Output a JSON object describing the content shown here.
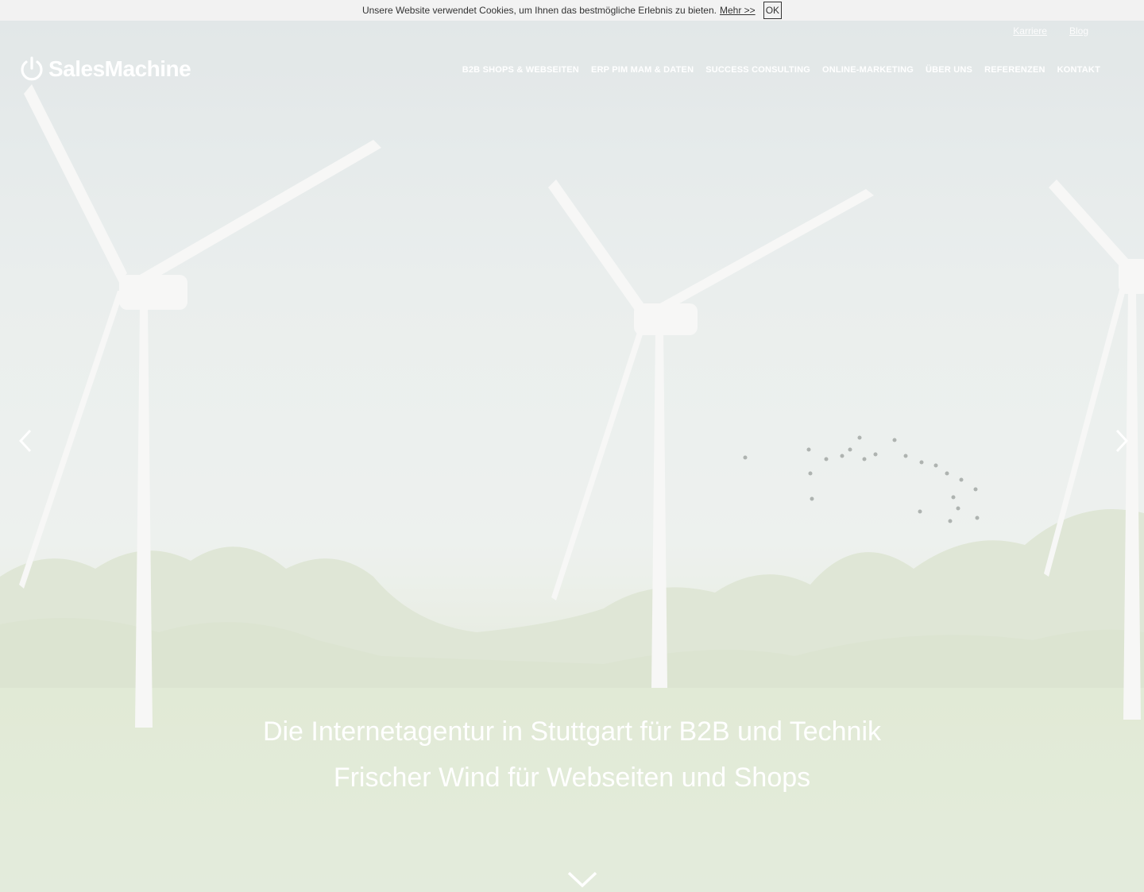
{
  "cookie": {
    "text": "Unsere Website verwendet Cookies, um Ihnen das bestmögliche Erlebnis zu bieten.",
    "more_label": "Mehr >>",
    "ok_label": "OK"
  },
  "top_links": [
    "Karriere",
    "Blog"
  ],
  "logo": {
    "text": "SalesMachine"
  },
  "nav": [
    "B2B SHOPS & WEBSEITEN",
    "ERP PIM MAM & DATEN",
    "SUCCESS CONSULTING",
    "ONLINE-MARKETING",
    "ÜBER UNS",
    "REFERENZEN",
    "KONTAKT"
  ],
  "hero": {
    "headline1": "Die Internetagentur in Stuttgart für B2B und Technik",
    "headline2": "Frischer Wind für Webseiten und Shops"
  },
  "icons": {
    "logo": "power-icon",
    "prev": "chevron-left-icon",
    "next": "chevron-right-icon",
    "scroll": "chevron-down-icon"
  },
  "colors": {
    "nav_text": "#ffffff",
    "cookie_bg": "#f2f2f2"
  }
}
